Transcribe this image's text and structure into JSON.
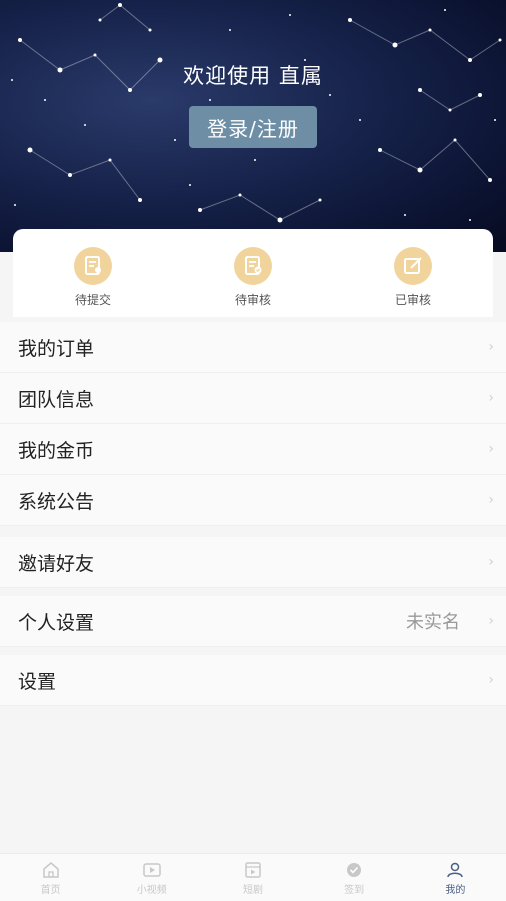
{
  "header": {
    "welcome_text": "欢迎使用 直属",
    "login_label": "登录/注册"
  },
  "status": {
    "items": [
      {
        "label": "待提交",
        "icon": "document-user-icon"
      },
      {
        "label": "待审核",
        "icon": "document-check-icon"
      },
      {
        "label": "已审核",
        "icon": "edit-icon"
      }
    ],
    "icon_color": "#f0d49c"
  },
  "menu": {
    "group1": [
      {
        "label": "我的订单"
      },
      {
        "label": "团队信息"
      },
      {
        "label": "我的金币"
      },
      {
        "label": "系统公告"
      }
    ],
    "invite": {
      "label": "邀请好友"
    },
    "personal": {
      "label": "个人设置",
      "value": "未实名"
    },
    "settings": {
      "label": "设置"
    }
  },
  "tabbar": {
    "items": [
      {
        "label": "首页",
        "icon": "home-icon"
      },
      {
        "label": "小视频",
        "icon": "video-icon"
      },
      {
        "label": "短剧",
        "icon": "film-icon"
      },
      {
        "label": "签到",
        "icon": "checkin-icon"
      },
      {
        "label": "我的",
        "icon": "user-icon"
      }
    ],
    "active_color": "#4a5e86"
  }
}
